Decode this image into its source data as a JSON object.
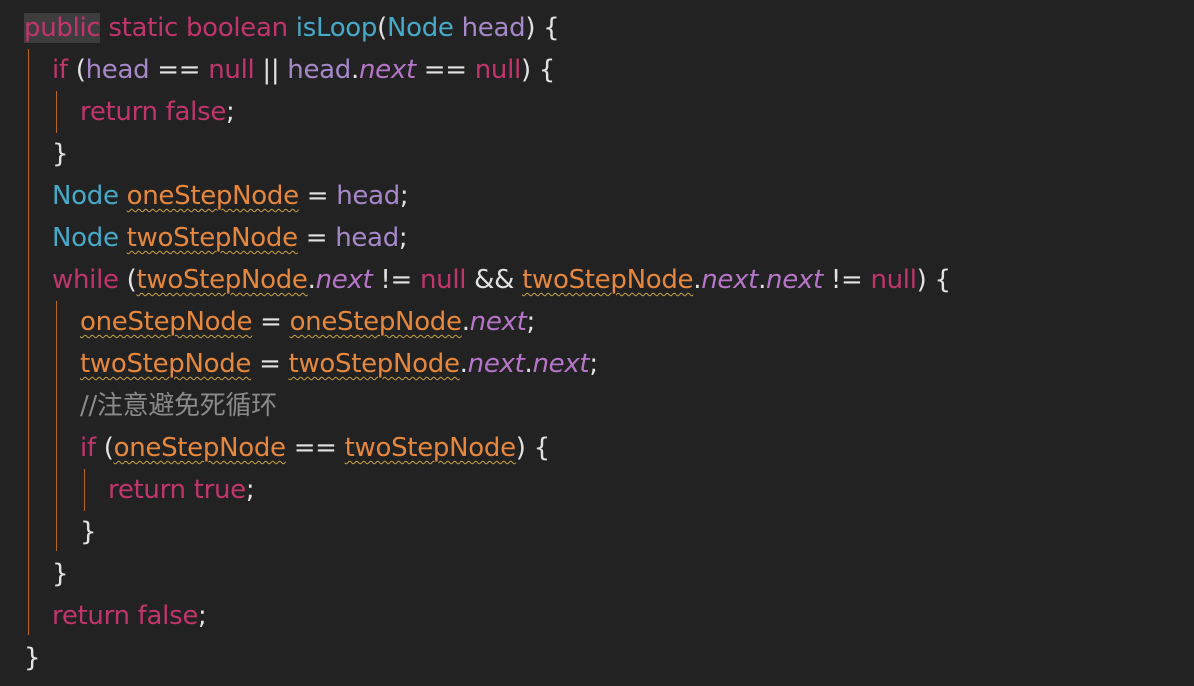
{
  "editor": {
    "language": "java",
    "theme_colors": {
      "background": "#222222",
      "keyword": "#c0356a",
      "type": "#46a9c8",
      "parameter": "#a688c9",
      "local_variable": "#e6873e",
      "field": "#b675c9",
      "text": "#e2e2e2",
      "comment": "#8a8a8a",
      "indent_guide": "#b8651f"
    },
    "lines": [
      {
        "tokens": [
          {
            "t": "public",
            "c": "kw hl-public"
          },
          {
            "t": " ",
            "c": "punc"
          },
          {
            "t": "static",
            "c": "kw"
          },
          {
            "t": " ",
            "c": "punc"
          },
          {
            "t": "boolean",
            "c": "kw"
          },
          {
            "t": " ",
            "c": "punc"
          },
          {
            "t": "isLoop",
            "c": "fn"
          },
          {
            "t": "(",
            "c": "punc"
          },
          {
            "t": "Node",
            "c": "type"
          },
          {
            "t": " ",
            "c": "punc"
          },
          {
            "t": "head",
            "c": "param"
          },
          {
            "t": ") {",
            "c": "punc"
          }
        ]
      },
      {
        "tokens": [
          {
            "t": "if",
            "c": "kw"
          },
          {
            "t": " (",
            "c": "punc"
          },
          {
            "t": "head",
            "c": "param"
          },
          {
            "t": " == ",
            "c": "punc"
          },
          {
            "t": "null",
            "c": "null"
          },
          {
            "t": " || ",
            "c": "punc"
          },
          {
            "t": "head",
            "c": "param"
          },
          {
            "t": ".",
            "c": "punc"
          },
          {
            "t": "next",
            "c": "field"
          },
          {
            "t": " == ",
            "c": "punc"
          },
          {
            "t": "null",
            "c": "null"
          },
          {
            "t": ") {",
            "c": "punc"
          }
        ]
      },
      {
        "tokens": [
          {
            "t": "return",
            "c": "kw"
          },
          {
            "t": " ",
            "c": "punc"
          },
          {
            "t": "false",
            "c": "kw"
          },
          {
            "t": ";",
            "c": "punc"
          }
        ]
      },
      {
        "tokens": [
          {
            "t": "}",
            "c": "punc"
          }
        ]
      },
      {
        "tokens": [
          {
            "t": "Node",
            "c": "type"
          },
          {
            "t": " ",
            "c": "punc"
          },
          {
            "t": "oneStepNode",
            "c": "var"
          },
          {
            "t": " = ",
            "c": "punc"
          },
          {
            "t": "head",
            "c": "param"
          },
          {
            "t": ";",
            "c": "punc"
          }
        ]
      },
      {
        "tokens": [
          {
            "t": "Node",
            "c": "type"
          },
          {
            "t": " ",
            "c": "punc"
          },
          {
            "t": "twoStepNode",
            "c": "var"
          },
          {
            "t": " = ",
            "c": "punc"
          },
          {
            "t": "head",
            "c": "param"
          },
          {
            "t": ";",
            "c": "punc"
          }
        ]
      },
      {
        "tokens": [
          {
            "t": "while",
            "c": "kw"
          },
          {
            "t": " (",
            "c": "punc"
          },
          {
            "t": "twoStepNode",
            "c": "var"
          },
          {
            "t": ".",
            "c": "punc"
          },
          {
            "t": "next",
            "c": "field"
          },
          {
            "t": " != ",
            "c": "punc"
          },
          {
            "t": "null",
            "c": "null"
          },
          {
            "t": " && ",
            "c": "punc"
          },
          {
            "t": "twoStepNode",
            "c": "var"
          },
          {
            "t": ".",
            "c": "punc"
          },
          {
            "t": "next",
            "c": "field"
          },
          {
            "t": ".",
            "c": "punc"
          },
          {
            "t": "next",
            "c": "field"
          },
          {
            "t": " != ",
            "c": "punc"
          },
          {
            "t": "null",
            "c": "null"
          },
          {
            "t": ") {",
            "c": "punc"
          }
        ]
      },
      {
        "tokens": [
          {
            "t": "oneStepNode",
            "c": "var"
          },
          {
            "t": " = ",
            "c": "punc"
          },
          {
            "t": "oneStepNode",
            "c": "var"
          },
          {
            "t": ".",
            "c": "punc"
          },
          {
            "t": "next",
            "c": "field"
          },
          {
            "t": ";",
            "c": "punc"
          }
        ]
      },
      {
        "tokens": [
          {
            "t": "twoStepNode",
            "c": "var"
          },
          {
            "t": " = ",
            "c": "punc"
          },
          {
            "t": "twoStepNode",
            "c": "var"
          },
          {
            "t": ".",
            "c": "punc"
          },
          {
            "t": "next",
            "c": "field"
          },
          {
            "t": ".",
            "c": "punc"
          },
          {
            "t": "next",
            "c": "field"
          },
          {
            "t": ";",
            "c": "punc"
          }
        ]
      },
      {
        "tokens": [
          {
            "t": "//注意避免死循环",
            "c": "comment"
          }
        ]
      },
      {
        "tokens": [
          {
            "t": "if",
            "c": "kw"
          },
          {
            "t": " (",
            "c": "punc"
          },
          {
            "t": "oneStepNode",
            "c": "var"
          },
          {
            "t": " == ",
            "c": "punc"
          },
          {
            "t": "twoStepNode",
            "c": "var"
          },
          {
            "t": ") {",
            "c": "punc"
          }
        ]
      },
      {
        "tokens": [
          {
            "t": "return",
            "c": "kw"
          },
          {
            "t": " ",
            "c": "punc"
          },
          {
            "t": "true",
            "c": "kw"
          },
          {
            "t": ";",
            "c": "punc"
          }
        ]
      },
      {
        "tokens": [
          {
            "t": "}",
            "c": "punc"
          }
        ]
      },
      {
        "tokens": [
          {
            "t": "}",
            "c": "punc"
          }
        ]
      },
      {
        "tokens": [
          {
            "t": "return",
            "c": "kw"
          },
          {
            "t": " ",
            "c": "punc"
          },
          {
            "t": "false",
            "c": "kw"
          },
          {
            "t": ";",
            "c": "punc"
          }
        ]
      },
      {
        "tokens": [
          {
            "t": "}",
            "c": "punc"
          }
        ]
      }
    ]
  }
}
